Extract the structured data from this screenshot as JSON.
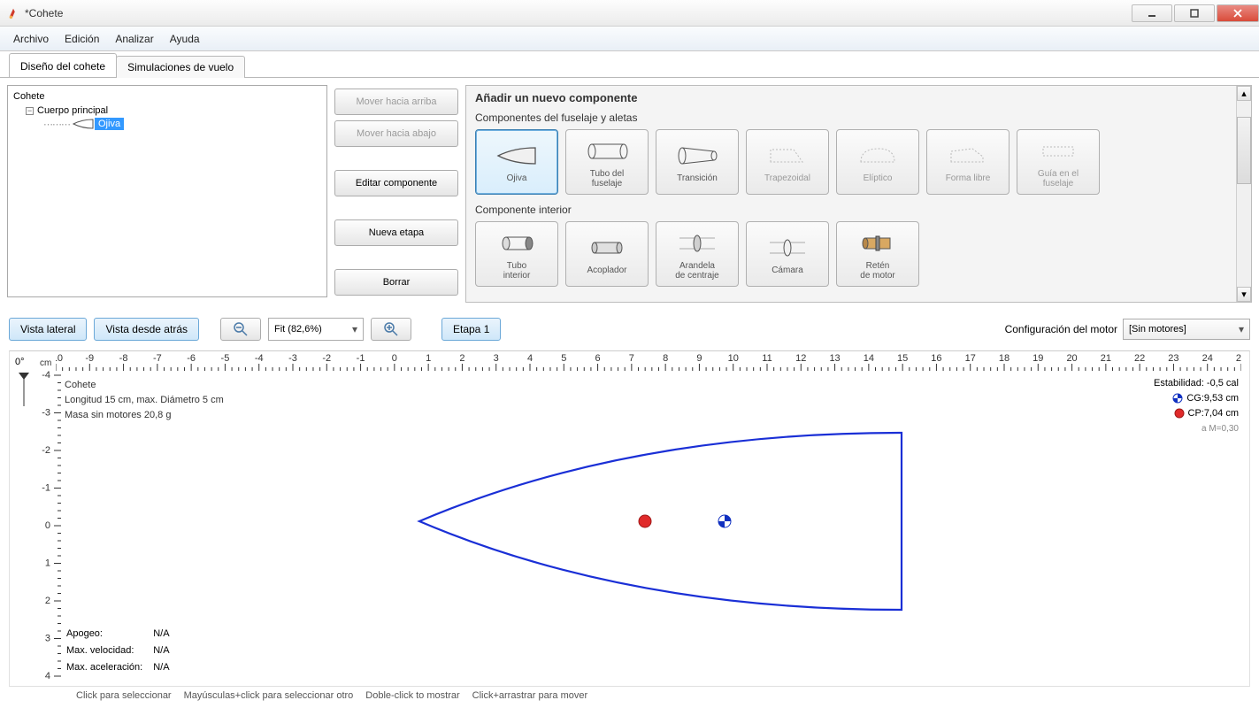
{
  "window": {
    "title": "*Cohete"
  },
  "menu": {
    "archivo": "Archivo",
    "edicion": "Edición",
    "analizar": "Analizar",
    "ayuda": "Ayuda"
  },
  "tabs": {
    "design": "Diseño del cohete",
    "sim": "Simulaciones de vuelo"
  },
  "tree": {
    "root": "Cohete",
    "body": "Cuerpo principal",
    "nose": "Ojiva"
  },
  "buttons": {
    "moveUp": "Mover hacia arriba",
    "moveDown": "Mover hacia abajo",
    "edit": "Editar componente",
    "newStage": "Nueva etapa",
    "delete": "Borrar"
  },
  "compPanel": {
    "title": "Añadir un nuevo componente",
    "section1": "Componentes del fuselaje y aletas",
    "section2": "Componente interior",
    "row1": {
      "ojiva": "Ojiva",
      "tubo": "Tubo del\nfuselaje",
      "transicion": "Transición",
      "trapezoidal": "Trapezoidal",
      "eliptico": "Elíptico",
      "libre": "Forma libre",
      "guia": "Guía en el\nfuselaje"
    },
    "row2": {
      "tuboInt": "Tubo\ninterior",
      "acoplador": "Acoplador",
      "arandela": "Arandela\nde centraje",
      "camara": "Cámara",
      "reten": "Retén\nde motor"
    }
  },
  "toolbar": {
    "sideView": "Vista lateral",
    "backView": "Vista desde atrás",
    "zoom": "Fit (82,6%)",
    "stage": "Etapa 1",
    "motorConfig": "Configuración del motor",
    "motorSel": "[Sin motores]"
  },
  "ruler": {
    "deg": "0°",
    "unit": "cm"
  },
  "info": {
    "name": "Cohete",
    "dims": "Longitud 15 cm, max. Diámetro 5 cm",
    "mass": "Masa sin motores 20,8 g"
  },
  "stats": {
    "apogeeL": "Apogeo:",
    "apogeeV": "N/A",
    "velL": "Max. velocidad:",
    "velV": "N/A",
    "accL": "Max. aceleración:",
    "accV": "N/A"
  },
  "right": {
    "stab": "Estabilidad: -0,5 cal",
    "cg": "CG:9,53 cm",
    "cp": "CP:7,04 cm",
    "mach": "a M=0,30"
  },
  "status": {
    "s1": "Click para seleccionar",
    "s2": "Mayúsculas+click para seleccionar otro",
    "s3": "Doble-click to mostrar",
    "s4": "Click+arrastrar para mover"
  }
}
